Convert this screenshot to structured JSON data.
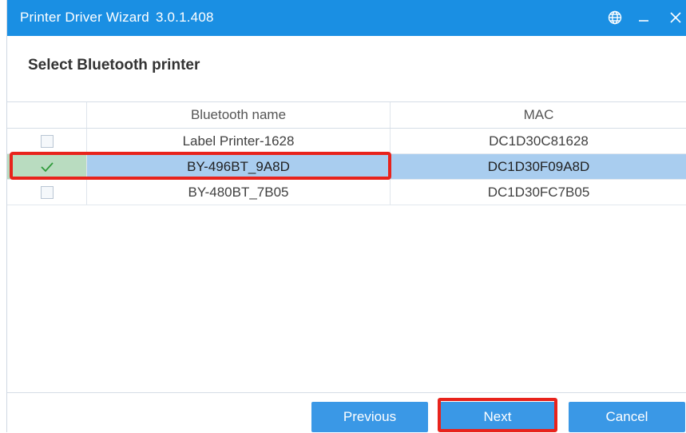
{
  "window": {
    "title": "Printer Driver Wizard",
    "version": "3.0.1.408",
    "icons": [
      "globe-icon",
      "minimize-icon",
      "close-icon"
    ]
  },
  "page": {
    "heading": "Select Bluetooth printer"
  },
  "table": {
    "columns": [
      "",
      "Bluetooth name",
      "MAC"
    ],
    "rows": [
      {
        "checked": false,
        "name": "Label Printer-1628",
        "mac": "DC1D30C81628"
      },
      {
        "checked": true,
        "name": "BY-496BT_9A8D",
        "mac": "DC1D30F09A8D"
      },
      {
        "checked": false,
        "name": "BY-480BT_7B05",
        "mac": "DC1D30FC7B05"
      }
    ],
    "selected_row": 1
  },
  "buttons": {
    "previous": "Previous",
    "next": "Next",
    "cancel": "Cancel"
  },
  "colors": {
    "titlebar": "#1a8fe3",
    "button": "#3a98e6",
    "selection": "#a9cdef",
    "annotation": "#e8231c"
  }
}
